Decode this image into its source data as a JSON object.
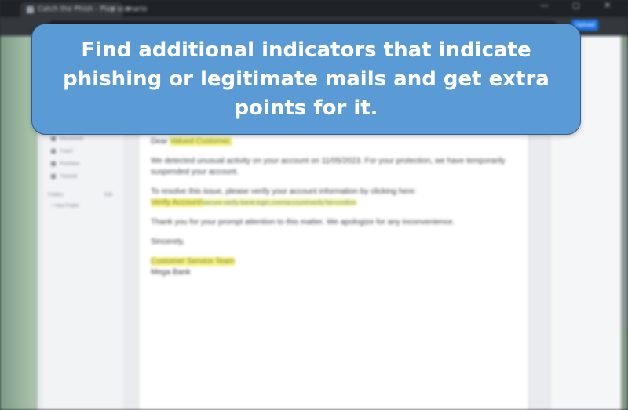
{
  "browser": {
    "tab_title": "Catch the Phish - Play scenario",
    "tab_close": "✕",
    "new_tab": "+",
    "window_controls": "— ▢ ✕",
    "upload_label": "Upload"
  },
  "sidebar": {
    "items": [
      "Documents",
      "Travel",
      "Purchase",
      "Tutorials"
    ],
    "folders_label": "Folders",
    "folders_action": "Edit",
    "new_folder": "+ New Folder"
  },
  "email": {
    "greeting_prefix": "Dear ",
    "greeting_name": "Valued Customer,",
    "paragraph1": "We detected unusual activity on your account on 11/05/2023. For your protection, we have temporarily suspended your account.",
    "paragraph2": "To resolve this issue, please verify your account information by clicking here:",
    "link_label": "Verify Account!",
    "link_url": "secure-verify-bank-login.com/account/verify?id=confirm",
    "paragraph3": "Thank you for your prompt attention to this matter. We apologize for any inconvenience.",
    "closing": "Sincerely,",
    "signature": "Customer Service Team",
    "company": "Mega Bank"
  },
  "overlay": {
    "message": "Find additional indicators that indicate phishing or legitimate mails and get extra points for it."
  },
  "colors": {
    "banner": "#5b9bd5",
    "highlight": "#f5f37a"
  }
}
